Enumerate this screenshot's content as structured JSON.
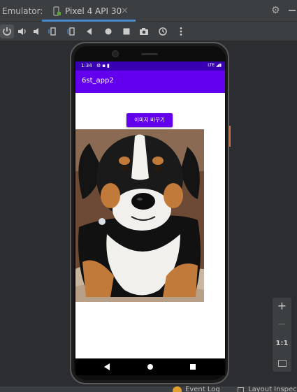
{
  "ide": {
    "emulator_label": "Emulator:",
    "tab_label": "Pixel 4 API 30",
    "tab_close": "×",
    "event_log": "Event Log",
    "layout_inspector": "Layout Inspec"
  },
  "toolbar": {
    "icons": [
      "power-icon",
      "volume-up-icon",
      "volume-down-icon",
      "rotate-left-icon",
      "rotate-right-icon",
      "back-icon",
      "home-icon",
      "overview-icon",
      "camera-icon",
      "snapshot-icon",
      "more-icon"
    ]
  },
  "zoom": {
    "plus": "+",
    "minus": "−",
    "one_to_one": "1:1"
  },
  "device": {
    "status_time": "1:34",
    "status_network": "LTE",
    "app_title": "6st_app2",
    "button_label": "이미지 바꾸기",
    "image_desc": "dog-photo"
  },
  "colors": {
    "ide_bg": "#2b2d30",
    "panel": "#3c3f41",
    "status_bar": "#3700b3",
    "app_bar": "#6200ee",
    "button": "#6200ee",
    "tab_underline": "#4a88c7"
  }
}
